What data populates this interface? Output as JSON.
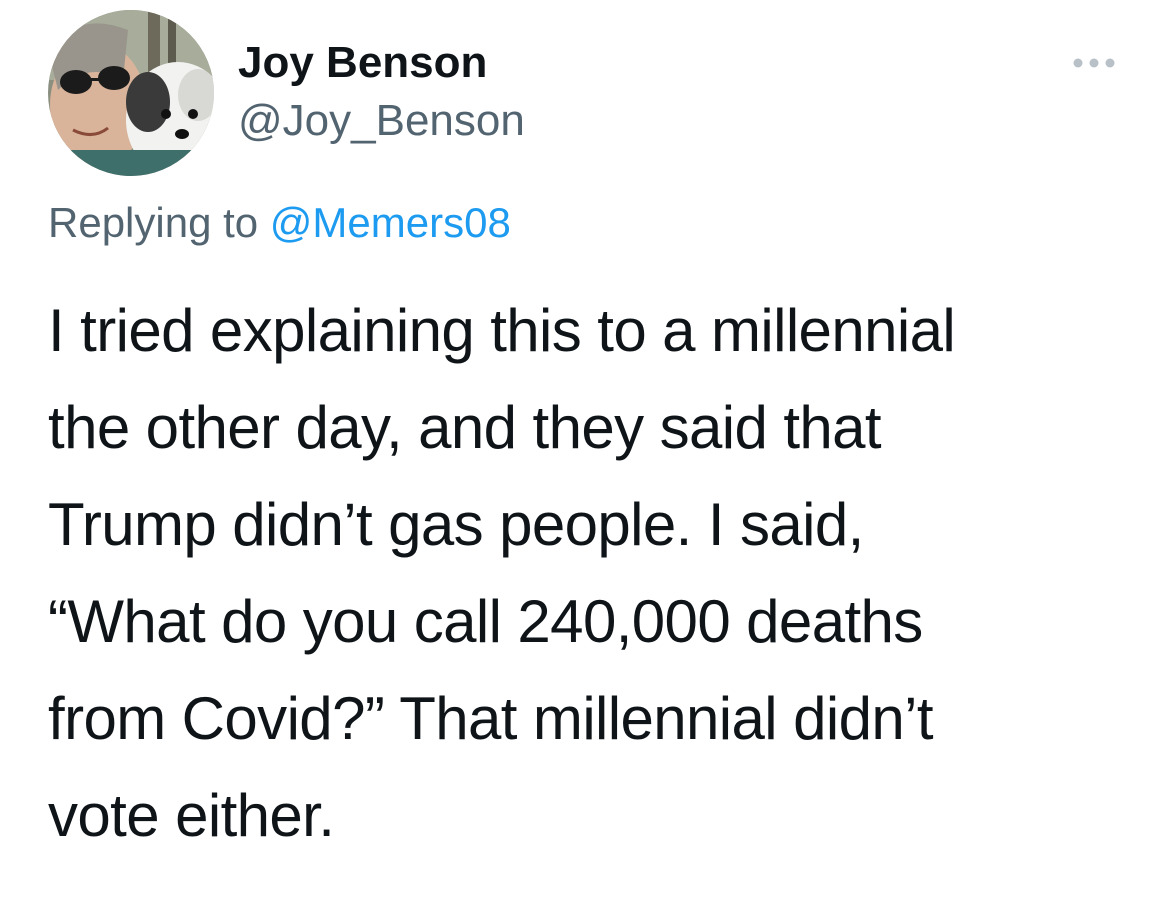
{
  "tweet": {
    "author": {
      "display_name": "Joy Benson",
      "handle": "@Joy_Benson",
      "avatar_icon": "avatar-photo-woman-with-dog"
    },
    "more_icon": "more-options-icon",
    "reply_context": {
      "prefix": "Replying to",
      "mention": "@Memers08"
    },
    "text_lines": [
      "I tried explaining this to a millennial",
      "the other day, and they said that",
      "Trump didn’t gas people. I said,",
      "“What do you call 240,000 deaths",
      "from Covid?” That millennial didn’t",
      "vote either."
    ]
  },
  "colors": {
    "text_primary": "#0f1419",
    "text_secondary": "#536471",
    "link": "#1d9bf0",
    "background": "#ffffff"
  }
}
